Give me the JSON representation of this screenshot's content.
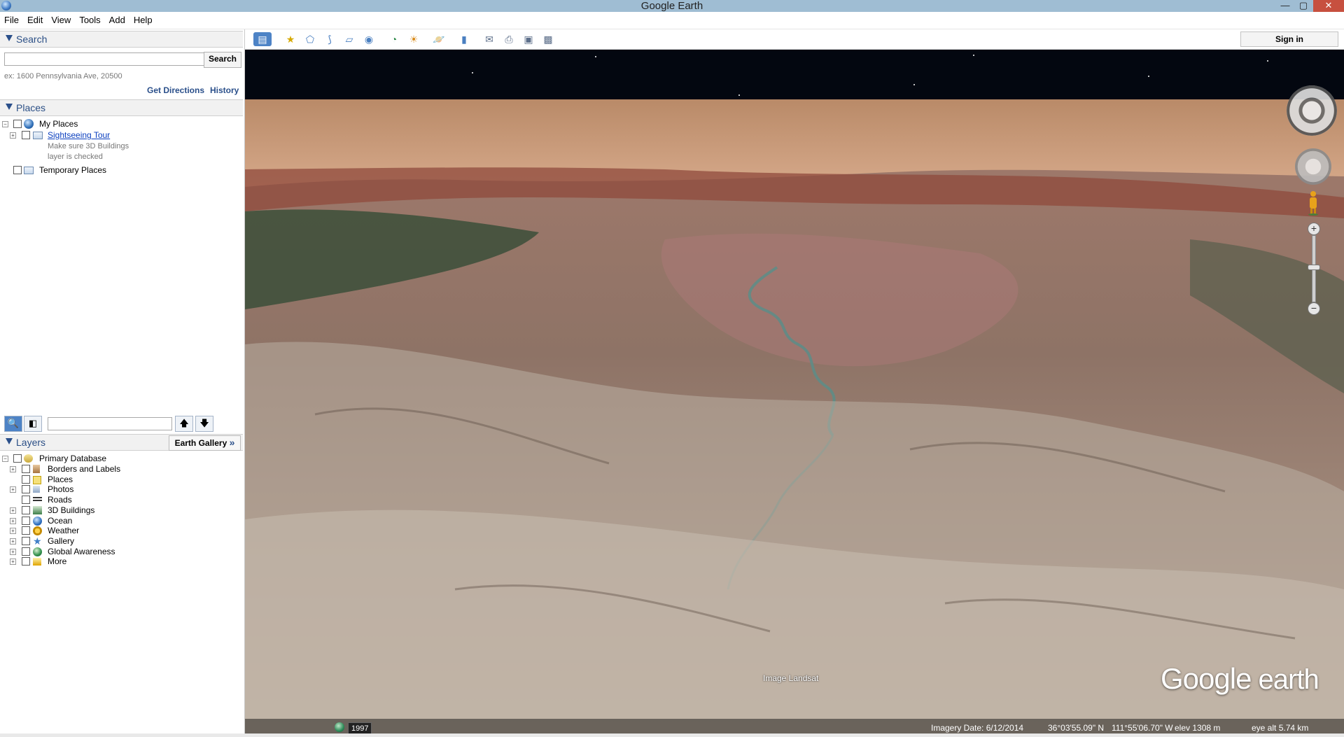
{
  "window": {
    "title": "Google Earth",
    "minimize": "—",
    "maximize": "▢",
    "close": "✕"
  },
  "menu": [
    "File",
    "Edit",
    "View",
    "Tools",
    "Add",
    "Help"
  ],
  "search": {
    "header": "Search",
    "input_value": "",
    "button": "Search",
    "hint": "ex: 1600 Pennsylvania Ave, 20500",
    "get_directions": "Get Directions",
    "history": "History"
  },
  "places": {
    "header": "Places",
    "my_places": "My Places",
    "sightseeing_tour": "Sightseeing Tour",
    "note_line1": "Make sure 3D Buildings",
    "note_line2": "layer is checked",
    "temporary_places": "Temporary Places"
  },
  "layers": {
    "header": "Layers",
    "earth_gallery": "Earth Gallery",
    "earth_gallery_arrow": "»",
    "primary": "Primary Database",
    "items": [
      "Borders and Labels",
      "Places",
      "Photos",
      "Roads",
      "3D Buildings",
      "Ocean",
      "Weather",
      "Gallery",
      "Global Awareness",
      "More"
    ]
  },
  "toolbar": {
    "sign_in": "Sign in"
  },
  "view": {
    "attribution": "Image Landsat",
    "logo_google": "Google",
    "logo_earth": " earth",
    "zoom_in": "+",
    "zoom_out": "−"
  },
  "status": {
    "year": "1997",
    "imagery_date": "Imagery Date: 6/12/2014",
    "lat": "36°03'55.09\" N",
    "lon": "111°55'06.70\" W",
    "elev": "elev  1308 m",
    "eye_alt": "eye alt   5.74 km"
  },
  "colors": {
    "panel_header_text": "#2b4f86",
    "title_bar": "#9fbdd3",
    "link": "#0b3fbf"
  }
}
